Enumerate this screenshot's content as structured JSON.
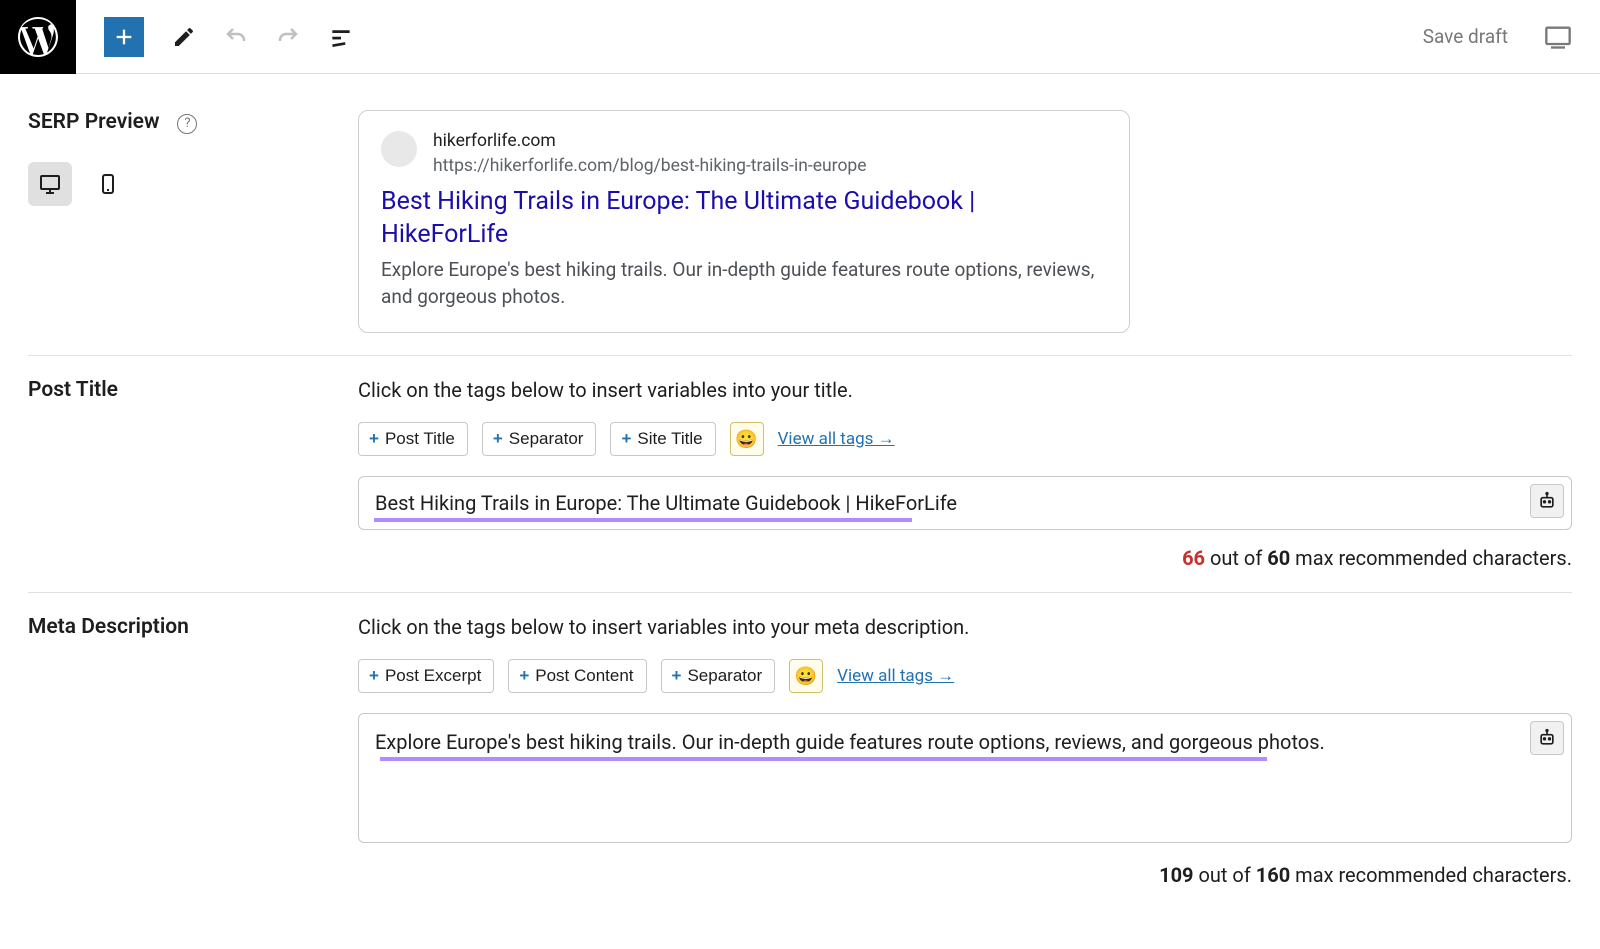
{
  "topbar": {
    "save_draft_label": "Save draft"
  },
  "serp": {
    "section_label": "SERP Preview",
    "domain": "hikerforlife.com",
    "url": "https://hikerforlife.com/blog/best-hiking-trails-in-europe",
    "title": "Best Hiking Trails in Europe: The Ultimate Guidebook | HikeForLife",
    "description": "Explore Europe's best hiking trails. Our in-depth guide features route options, reviews, and gorgeous photos."
  },
  "post_title": {
    "section_label": "Post Title",
    "instruction": "Click on the tags below to insert variables into your title.",
    "tags": {
      "post_title": "Post Title",
      "separator": "Separator",
      "site_title": "Site Title"
    },
    "view_all": "View all tags →",
    "value": "Best Hiking Trails in Europe: The Ultimate Guidebook | HikeForLife",
    "count": "66",
    "max": "60",
    "counter_mid": " out of ",
    "counter_suffix": " max recommended characters."
  },
  "meta_desc": {
    "section_label": "Meta Description",
    "instruction": "Click on the tags below to insert variables into your meta description.",
    "tags": {
      "post_excerpt": "Post Excerpt",
      "post_content": "Post Content",
      "separator": "Separator"
    },
    "view_all": "View all tags →",
    "value": "Explore Europe's best hiking trails. Our in-depth guide features route options, reviews, and gorgeous photos.",
    "count": "109",
    "max": "160",
    "counter_mid": " out of ",
    "counter_suffix": " max recommended characters."
  }
}
